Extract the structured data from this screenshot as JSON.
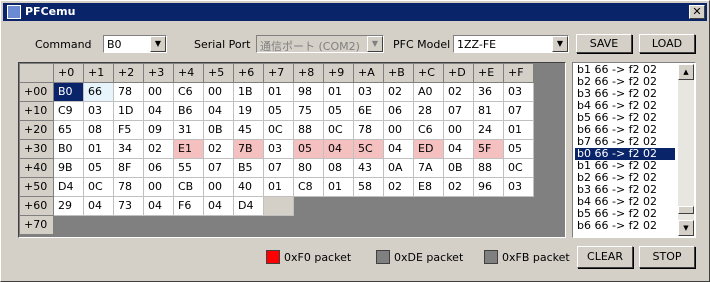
{
  "window": {
    "title": "PFCemu",
    "close_glyph": "✕"
  },
  "command": {
    "label": "Command",
    "value": "B0"
  },
  "serial": {
    "label": "Serial Port",
    "value": "通信ポート (COM2)"
  },
  "model": {
    "label": "PFC Model",
    "value": "1ZZ-FE"
  },
  "buttons": {
    "save": "SAVE",
    "load": "LOAD",
    "clear": "CLEAR",
    "stop": "STOP"
  },
  "grid": {
    "col_headers": [
      "+0",
      "+1",
      "+2",
      "+3",
      "+4",
      "+5",
      "+6",
      "+7",
      "+8",
      "+9",
      "+A",
      "+B",
      "+C",
      "+D",
      "+E",
      "+F"
    ],
    "row_headers": [
      "+00",
      "+10",
      "+20",
      "+30",
      "+40",
      "+50",
      "+60",
      "+70"
    ],
    "rows": [
      [
        "B0",
        "66",
        "78",
        "00",
        "C6",
        "00",
        "1B",
        "01",
        "98",
        "01",
        "03",
        "02",
        "A0",
        "02",
        "36",
        "03"
      ],
      [
        "C9",
        "03",
        "1D",
        "04",
        "B6",
        "04",
        "19",
        "05",
        "75",
        "05",
        "6E",
        "06",
        "28",
        "07",
        "81",
        "07"
      ],
      [
        "65",
        "08",
        "F5",
        "09",
        "31",
        "0B",
        "45",
        "0C",
        "88",
        "0C",
        "78",
        "00",
        "C6",
        "00",
        "24",
        "01"
      ],
      [
        "B0",
        "01",
        "34",
        "02",
        "E1",
        "02",
        "7B",
        "03",
        "05",
        "04",
        "5C",
        "04",
        "ED",
        "04",
        "5F",
        "05"
      ],
      [
        "9B",
        "05",
        "8F",
        "06",
        "55",
        "07",
        "B5",
        "07",
        "80",
        "08",
        "43",
        "0A",
        "7A",
        "0B",
        "88",
        "0C"
      ],
      [
        "D4",
        "0C",
        "78",
        "00",
        "CB",
        "00",
        "40",
        "01",
        "C8",
        "01",
        "58",
        "02",
        "E8",
        "02",
        "96",
        "03"
      ],
      [
        "29",
        "04",
        "73",
        "04",
        "F6",
        "04",
        "D4",
        "",
        "",
        "",
        "",
        "",
        "",
        "",
        "",
        ""
      ],
      [
        "",
        "",
        "",
        "",
        "",
        "",
        "",
        "",
        "",
        "",
        "",
        "",
        "",
        "",
        "",
        ""
      ]
    ]
  },
  "log": {
    "lines": [
      "b1 66 -> f2 02",
      "b2 66 -> f2 02",
      "b3 66 -> f2 02",
      "b4 66 -> f2 02",
      "b5 66 -> f2 02",
      "b6 66 -> f2 02",
      "b7 66 -> f2 02",
      "b0 66 -> f2 02",
      "b1 66 -> f2 02",
      "b2 66 -> f2 02",
      "b3 66 -> f2 02",
      "b4 66 -> f2 02",
      "b5 66 -> f2 02",
      "b6 66 -> f2 02"
    ],
    "selected_index": 7
  },
  "legend": [
    {
      "label": "0xF0 packet",
      "color": "#ff0000"
    },
    {
      "label": "0xDE packet",
      "color": "#808080"
    },
    {
      "label": "0xFB packet",
      "color": "#808080"
    }
  ],
  "colors": {
    "accent": "#0a246a",
    "highlight": "#f4c0c0"
  }
}
